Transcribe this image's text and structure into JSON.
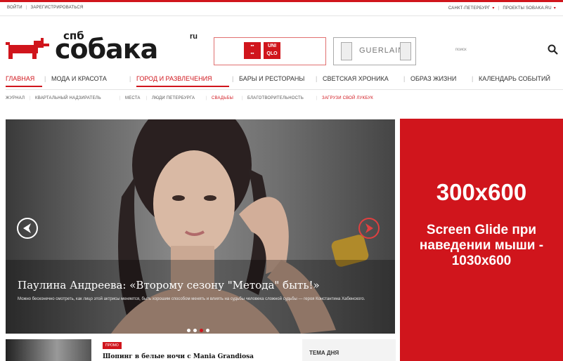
{
  "topbar": {
    "login": "ВОЙТИ",
    "register": "ЗАРЕГИСТРИРОВАТЬСЯ",
    "city": "САНКТ-ПЕТЕРБУРГ",
    "projects": "ПРОЕКТЫ SOBAKA.RU"
  },
  "logo": {
    "city": "спб",
    "word": "собака",
    "domain": "ru"
  },
  "ads": {
    "uniqlo_text": "UNI QLO",
    "guerlain_text": "GUERLAIN",
    "side_size": "300x600",
    "side_desc": "Screen Glide при наведении мыши - 1030x600"
  },
  "search": {
    "placeholder": "поиск"
  },
  "nav": {
    "items": [
      "ГЛАВНАЯ",
      "МОДА И КРАСОТА",
      "ГОРОД И РАЗВЛЕЧЕНИЯ",
      "БАРЫ И РЕСТОРАНЫ",
      "СВЕТСКАЯ ХРОНИКА",
      "ОБРАЗ ЖИЗНИ",
      "КАЛЕНДАРЬ СОБЫТИЙ"
    ]
  },
  "subnav": {
    "items": [
      "ЖУРНАЛ",
      "КВАРТАЛЬНЫЙ НАДЗИРАТЕЛЬ",
      "МЕСТА",
      "ЛЮДИ ПЕТЕРБУРГА",
      "СВАДЬБЫ",
      "БЛАГОТВОРИТЕЛЬНОСТЬ",
      "ЗАГРУЗИ СВОЙ ЛУКБУК"
    ]
  },
  "slider": {
    "title": "Паулина Андреева: «Второму сезону \"Метода\" быть!»",
    "text": "Можно бесконечно смотреть, как лицо этой актрисы меняется, быть хорошим способом менять и влиять на судьбы человека сложной судьбы — героя Константина Хабенского."
  },
  "teaser": {
    "tag": "ПРОМО",
    "title": "Шопинг в белые ночи с Mania Grandiosa",
    "topic": "ТЕМА ДНЯ"
  }
}
